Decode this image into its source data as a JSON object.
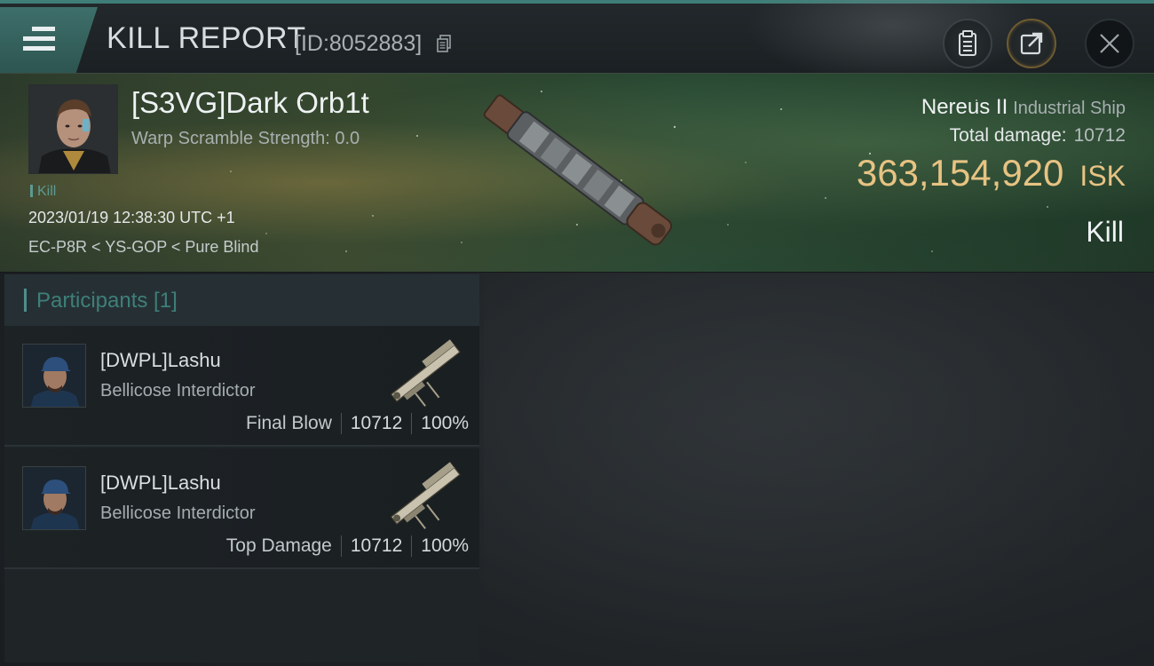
{
  "header": {
    "title": "KILL REPORT",
    "report_id": "[ID:8052883]"
  },
  "victim": {
    "name": "[S3VG]Dark Orb1t",
    "warp_scramble": "Warp Scramble Strength: 0.0",
    "tag": "Kill",
    "timestamp": "2023/01/19 12:38:30 UTC +1",
    "location": "EC-P8R < YS-GOP < Pure Blind"
  },
  "ship": {
    "name": "Nereus II",
    "class": "Industrial Ship",
    "damage_label": "Total damage:",
    "damage_value": "10712",
    "isk_value": "363,154,920",
    "isk_unit": "ISK",
    "result": "Kill"
  },
  "participants": {
    "title": "Participants [1]",
    "rows": [
      {
        "name": "[DWPL]Lashu",
        "ship": "Bellicose Interdictor",
        "role": "Final Blow",
        "damage": "10712",
        "percent": "100%"
      },
      {
        "name": "[DWPL]Lashu",
        "ship": "Bellicose Interdictor",
        "role": "Top Damage",
        "damage": "10712",
        "percent": "100%"
      }
    ]
  },
  "colors": {
    "accent_teal": "#3e7f79",
    "isk_gold": "#e7c383",
    "header_bg": "#1b2023"
  },
  "icons": {
    "menu": "menu-icon",
    "copy": "copy-icon",
    "clipboard": "clipboard-icon",
    "share": "share-icon",
    "close": "close-icon"
  }
}
